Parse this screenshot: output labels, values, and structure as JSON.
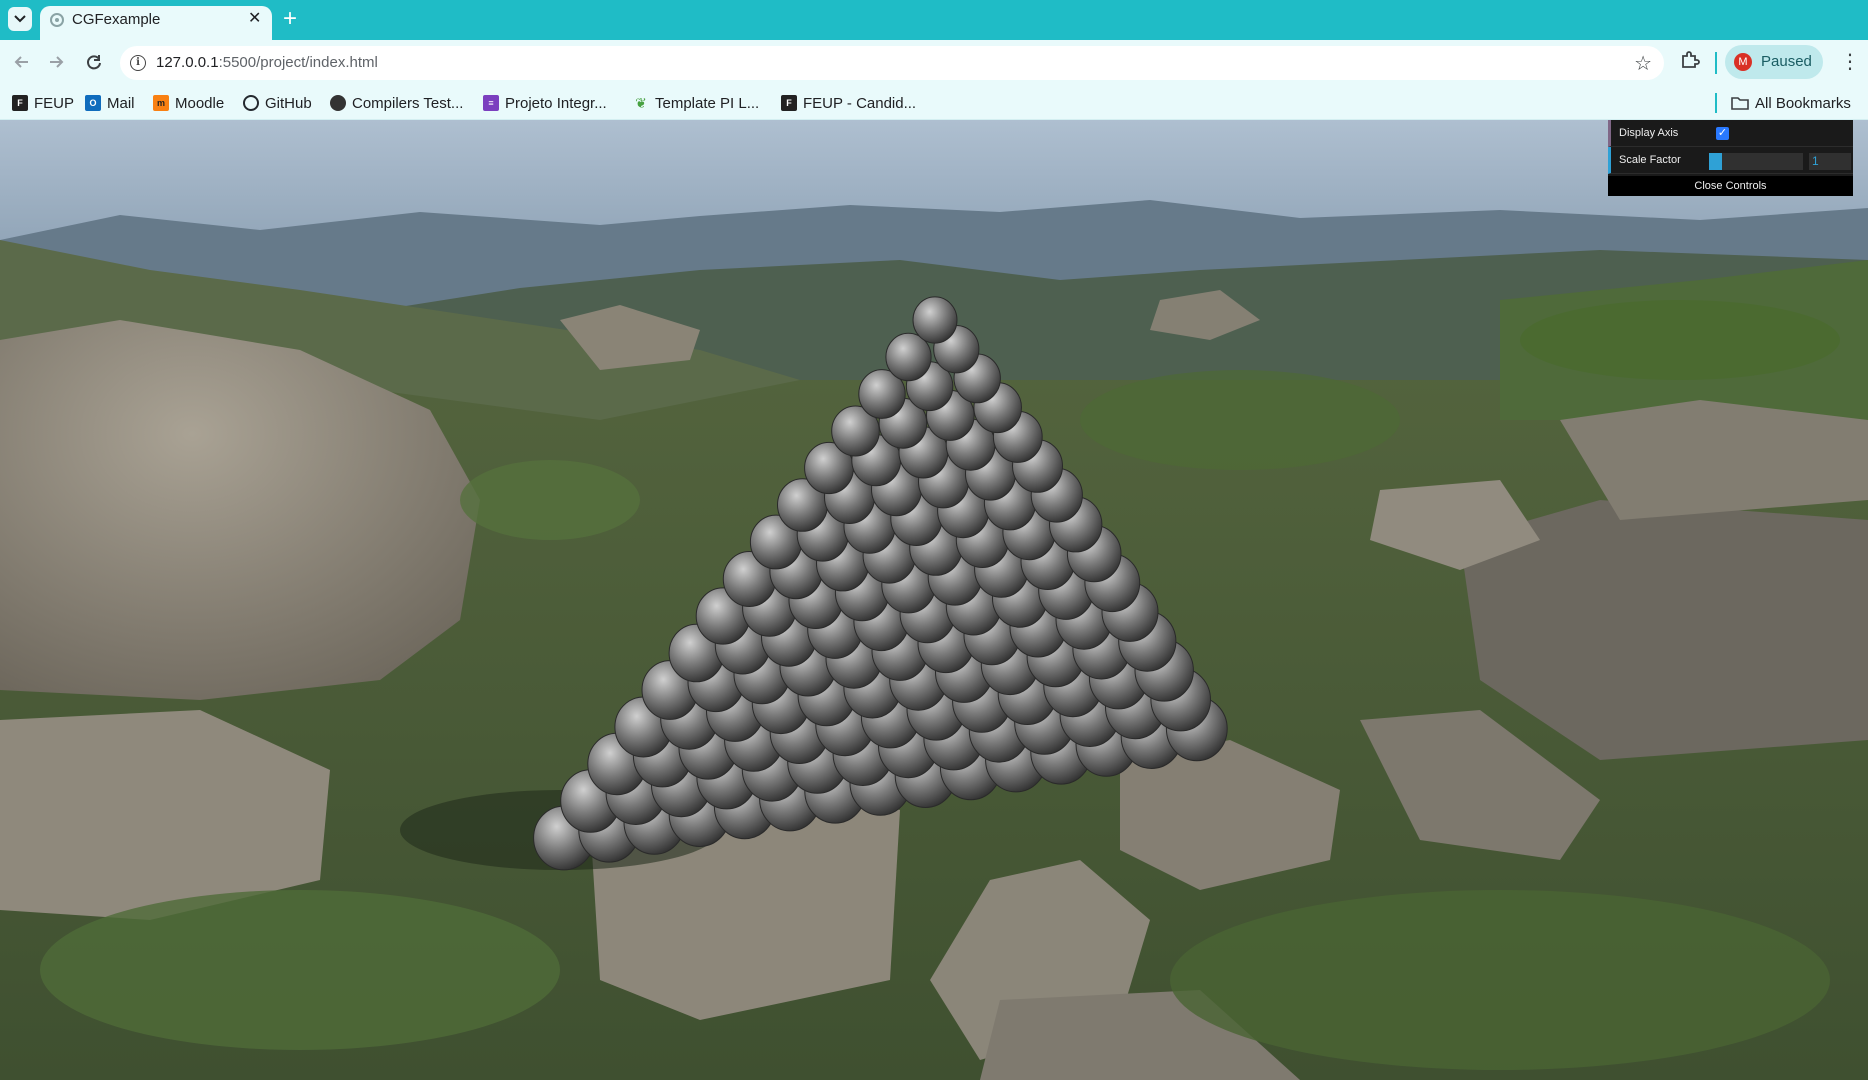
{
  "browser": {
    "tab_title": "CGFexample",
    "url_host": "127.0.0.1",
    "url_rest": ":5500/project/index.html",
    "profile_initial": "M",
    "profile_status": "Paused",
    "icons": {
      "tab_list": "chevron-down-icon",
      "favicon": "globe-icon",
      "close": "close-icon",
      "new_tab": "plus-icon",
      "back": "back-arrow-icon",
      "forward": "forward-arrow-icon",
      "reload": "reload-icon",
      "site_info": "info-icon",
      "bookmark_star": "star-icon",
      "extensions": "puzzle-icon",
      "menu": "more-vert-icon",
      "folder": "folder-icon"
    }
  },
  "bookmarks": [
    {
      "label": "FEUP",
      "icon": "feup-logo-icon"
    },
    {
      "label": "Mail",
      "icon": "outlook-icon"
    },
    {
      "label": "Moodle",
      "icon": "moodle-icon"
    },
    {
      "label": "GitHub",
      "icon": "github-icon"
    },
    {
      "label": "Compilers Test...",
      "icon": "circle-logo-icon"
    },
    {
      "label": "Projeto Integr...",
      "icon": "purple-list-icon"
    },
    {
      "label": "Template PI L...",
      "icon": "overleaf-icon"
    },
    {
      "label": "FEUP - Candid...",
      "icon": "feup-logo-icon"
    }
  ],
  "all_bookmarks": "All Bookmarks",
  "gui": {
    "display_axis_label": "Display Axis",
    "display_axis_checked": true,
    "scale_factor_label": "Scale Factor",
    "scale_factor_value": "1",
    "scale_factor_fraction": 0.14,
    "close_label": "Close Controls"
  },
  "colors": {
    "tabstrip": "#1fbcc6",
    "toolbar": "#e9fafb",
    "gui_bg": "#1a1a1a",
    "gui_accent": "#2fa1d6",
    "checkbox": "#2979ff"
  }
}
